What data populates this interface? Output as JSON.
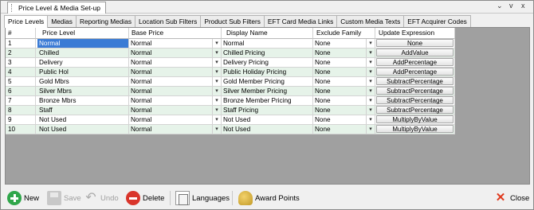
{
  "window": {
    "doc_tab_title": "Price Level & Media Set-up",
    "controls": [
      "⌄",
      "v",
      "x"
    ]
  },
  "tabs": [
    {
      "label": "Price Levels",
      "active": true
    },
    {
      "label": "Medias"
    },
    {
      "label": "Reporting Medias"
    },
    {
      "label": "Location Sub Filters"
    },
    {
      "label": "Product Sub Filters"
    },
    {
      "label": "EFT Card Media Links"
    },
    {
      "label": "Custom Media Texts"
    },
    {
      "label": "EFT Acquirer Codes"
    }
  ],
  "grid": {
    "columns": [
      "#",
      "Price Level",
      "Base Price",
      "Display Name",
      "Exclude Family",
      "Update Expression"
    ],
    "rows": [
      {
        "num": "1",
        "level": "Normal",
        "base": "Normal",
        "display": "Normal",
        "exclude": "None",
        "update": "None",
        "selected": true
      },
      {
        "num": "2",
        "level": "Chilled",
        "base": "Normal",
        "display": "Chilled Pricing",
        "exclude": "None",
        "update": "AddValue"
      },
      {
        "num": "3",
        "level": "Delivery",
        "base": "Normal",
        "display": "Delivery Pricing",
        "exclude": "None",
        "update": "AddPercentage"
      },
      {
        "num": "4",
        "level": "Public Hol",
        "base": "Normal",
        "display": "Public Holiday Pricing",
        "exclude": "None",
        "update": "AddPercentage"
      },
      {
        "num": "5",
        "level": "Gold Mbrs",
        "base": "Normal",
        "display": "Gold Member Pricing",
        "exclude": "None",
        "update": "SubtractPercentage"
      },
      {
        "num": "6",
        "level": "Silver Mbrs",
        "base": "Normal",
        "display": "Silver Member Pricing",
        "exclude": "None",
        "update": "SubtractPercentage"
      },
      {
        "num": "7",
        "level": "Bronze Mbrs",
        "base": "Normal",
        "display": "Bronze Member Pricing",
        "exclude": "None",
        "update": "SubtractPercentage"
      },
      {
        "num": "8",
        "level": "Staff",
        "base": "Normal",
        "display": "Staff Pricing",
        "exclude": "None",
        "update": "SubtractPercentage"
      },
      {
        "num": "9",
        "level": "Not Used",
        "base": "Normal",
        "display": "Not Used",
        "exclude": "None",
        "update": "MultiplyByValue"
      },
      {
        "num": "10",
        "level": "Not Used",
        "base": "Normal",
        "display": "Not Used",
        "exclude": "None",
        "update": "MultiplyByValue"
      }
    ]
  },
  "toolbar": {
    "new_label": "New",
    "save_label": "Save",
    "undo_label": "Undo",
    "delete_label": "Delete",
    "languages_label": "Languages",
    "award_label": "Award Points",
    "close_label": "Close"
  },
  "colors": {
    "selected_row": "#3a7bd5",
    "alt_row": "#e6f3e9",
    "grid_background": "#a0a0a0"
  }
}
